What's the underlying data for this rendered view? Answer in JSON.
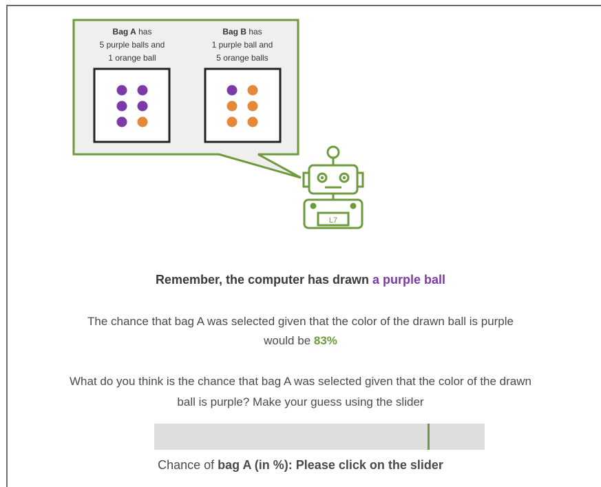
{
  "illustration": {
    "bag_a": {
      "name": "Bag A",
      "suffix": " has",
      "line2": "5 purple balls and",
      "line3": "1 orange ball"
    },
    "bag_b": {
      "name": "Bag B",
      "suffix": " has",
      "line2": "1 purple ball and",
      "line3": "5 orange balls"
    },
    "robot_label": "L7",
    "colors": {
      "purple": "#7b3aa8",
      "orange": "#e4883a",
      "green": "#6c9a3c"
    }
  },
  "remember": {
    "prefix": "Remember, the computer has drawn ",
    "highlight": "a purple ball"
  },
  "chance": {
    "line1": "The chance that bag A was selected given that the color of the drawn ball is purple",
    "line2_prefix": "would be ",
    "value": "83%"
  },
  "question": {
    "line1": "What do you think is the chance that bag A was selected given that the color of the drawn",
    "line2": "ball is purple? Make your guess using the slider"
  },
  "slider": {
    "marker_fraction": 0.83,
    "label_prefix": "Chance of ",
    "label_bold": "bag A (in %): Please click on the slider"
  }
}
